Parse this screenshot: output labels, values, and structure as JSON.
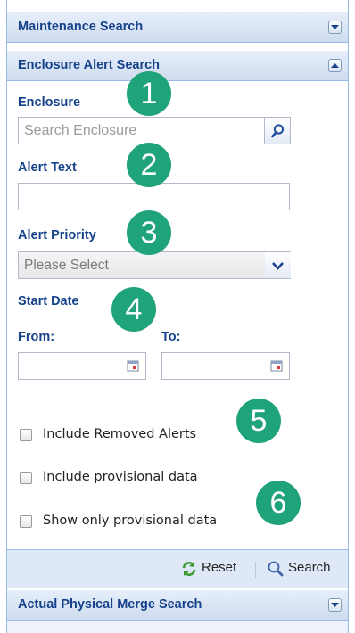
{
  "panels": {
    "maintenance": {
      "title": "Maintenance Search"
    },
    "enclosure_alert": {
      "title": "Enclosure Alert Search"
    },
    "actual_physical": {
      "title": "Actual Physical Merge Search"
    }
  },
  "form": {
    "enclosure_label": "Enclosure",
    "enclosure_placeholder": "Search Enclosure",
    "alert_text_label": "Alert Text",
    "alert_text_value": "",
    "alert_priority_label": "Alert Priority",
    "alert_priority_value": "Please Select",
    "start_date_label": "Start Date",
    "from_label": "From:",
    "to_label": "To:",
    "include_removed_label": "Include Removed Alerts",
    "include_provisional_label": "Include provisional data",
    "show_only_provisional_label": "Show only provisional data"
  },
  "footer": {
    "reset_label": "Reset",
    "search_label": "Search"
  },
  "badges": [
    "1",
    "2",
    "3",
    "4",
    "5",
    "6"
  ],
  "colors": {
    "header_text": "#15428b",
    "badge": "#1fa37b",
    "border": "#99bbe8"
  },
  "icons": {
    "enclosure_trigger": "search-icon",
    "priority_trigger": "chevron-down-icon",
    "date_trigger": "calendar-icon",
    "reset": "refresh-icon",
    "search": "magnifier-icon"
  }
}
